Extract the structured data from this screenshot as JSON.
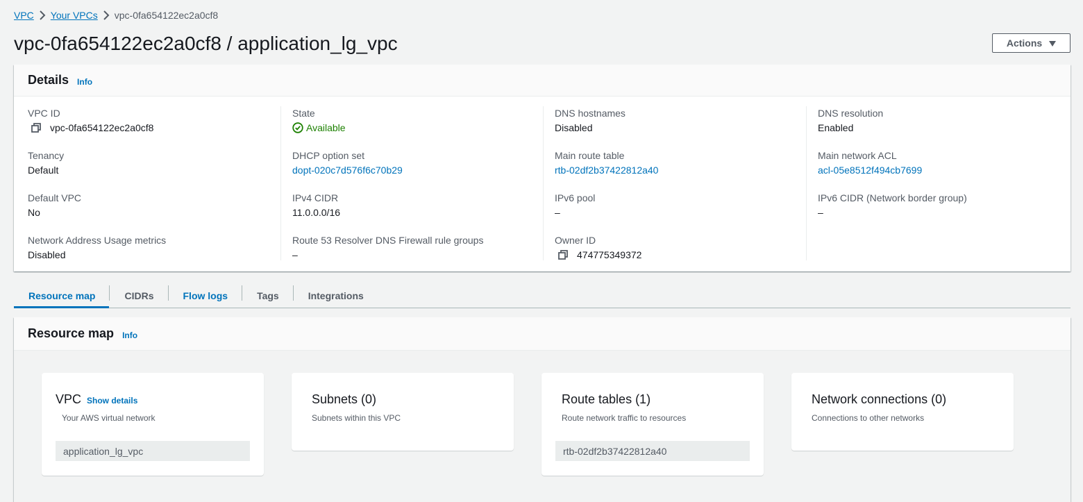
{
  "breadcrumb": {
    "items": [
      {
        "label": "VPC"
      },
      {
        "label": "Your VPCs"
      }
    ],
    "current": "vpc-0fa654122ec2a0cf8"
  },
  "header": {
    "title": "vpc-0fa654122ec2a0cf8 / application_lg_vpc",
    "actions_label": "Actions"
  },
  "details": {
    "title": "Details",
    "info": "Info",
    "col1": {
      "vpc_id": {
        "label": "VPC ID",
        "value": "vpc-0fa654122ec2a0cf8"
      },
      "tenancy": {
        "label": "Tenancy",
        "value": "Default"
      },
      "default_vpc": {
        "label": "Default VPC",
        "value": "No"
      },
      "nau_metrics": {
        "label": "Network Address Usage metrics",
        "value": "Disabled"
      }
    },
    "col2": {
      "state": {
        "label": "State",
        "value": "Available"
      },
      "dhcp": {
        "label": "DHCP option set",
        "value": "dopt-020c7d576f6c70b29"
      },
      "ipv4": {
        "label": "IPv4 CIDR",
        "value": "11.0.0.0/16"
      },
      "r53": {
        "label": "Route 53 Resolver DNS Firewall rule groups",
        "value": "–"
      }
    },
    "col3": {
      "dns_hostnames": {
        "label": "DNS hostnames",
        "value": "Disabled"
      },
      "main_route_table": {
        "label": "Main route table",
        "value": "rtb-02df2b37422812a40"
      },
      "ipv6_pool": {
        "label": "IPv6 pool",
        "value": "–"
      },
      "owner_id": {
        "label": "Owner ID",
        "value": "474775349372"
      }
    },
    "col4": {
      "dns_resolution": {
        "label": "DNS resolution",
        "value": "Enabled"
      },
      "main_acl": {
        "label": "Main network ACL",
        "value": "acl-05e8512f494cb7699"
      },
      "ipv6_cidr": {
        "label": "IPv6 CIDR (Network border group)",
        "value": "–"
      }
    }
  },
  "tabs": [
    {
      "label": "Resource map"
    },
    {
      "label": "CIDRs"
    },
    {
      "label": "Flow logs"
    },
    {
      "label": "Tags"
    },
    {
      "label": "Integrations"
    }
  ],
  "resource_map": {
    "title": "Resource map",
    "info": "Info",
    "cards": {
      "vpc": {
        "title": "VPC",
        "action": "Show details",
        "subtitle": "Your AWS virtual network",
        "chip": "application_lg_vpc"
      },
      "subnets": {
        "title": "Subnets (0)",
        "subtitle": "Subnets within this VPC"
      },
      "route_tables": {
        "title": "Route tables (1)",
        "subtitle": "Route network traffic to resources",
        "chip": "rtb-02df2b37422812a40"
      },
      "network_connections": {
        "title": "Network connections (0)",
        "subtitle": "Connections to other networks"
      }
    }
  },
  "colors": {
    "link": "#0073bb",
    "success": "#1d8102",
    "background": "#f2f3f3",
    "text": "#16191f",
    "muted": "#545b64"
  },
  "icons": {
    "copy": "copy-icon",
    "status_ok": "check-circle-icon",
    "breadcrumb_sep": "chevron-right-icon",
    "dropdown": "caret-down-icon"
  }
}
